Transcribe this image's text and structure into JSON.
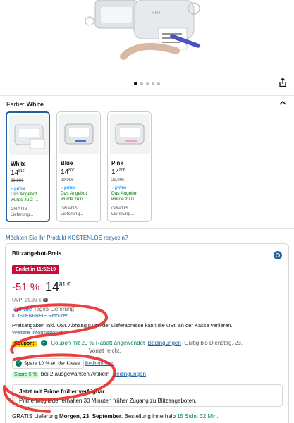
{
  "gallery": {
    "dots_count": 5,
    "active_dot": 0
  },
  "color_selector": {
    "label": "Farbe:",
    "selected": "White",
    "options": [
      {
        "name": "White",
        "price_whole": "14",
        "price_fraction": "81€",
        "old_price": "29,99€",
        "prime": "✓prime",
        "offer": "Das Angebot wurde zu 2 ...",
        "shipping": "GRATIS Lieferung...",
        "selected": true
      },
      {
        "name": "Blue",
        "price_whole": "14",
        "price_fraction": "80€",
        "old_price": "29,99€",
        "prime": "✓prime",
        "offer": "Das Angebot wurde zu 0 ...",
        "shipping": "GRATIS Lieferung...",
        "selected": false
      },
      {
        "name": "Pink",
        "price_whole": "14",
        "price_fraction": "80€",
        "old_price": "29,99€",
        "prime": "✓prime",
        "offer": "Das Angebot wurde zu 0 ...",
        "shipping": "GRATIS Lieferung...",
        "selected": false
      }
    ]
  },
  "recycle_link": "Möchten Sie Ihr Produkt KOSTENLOS recyceln?",
  "offer_card": {
    "title": "Blitzangebot-Preis",
    "deal_badge": "Endet in 11:52:19",
    "discount": "-51 %",
    "price_whole": "14",
    "price_fraction": "81 €",
    "uvp_label": "UVP:",
    "uvp_value": "29,99 €",
    "uvp_info": "i",
    "prime_label": "✓prime",
    "prime_text": "Tages-Lieferung",
    "returns": "KOSTENFREIE Retouren",
    "vat_text": "Preisangaben inkl. USt. Abhängig von der Lieferadresse kann die USt. an der Kasse variieren.",
    "vat_link": "Weitere Informationen.",
    "coupon_tag": "Coupon:",
    "coupon_text": "Coupon mit 20 % Rabatt angewendet",
    "coupon_terms": "Bedingungen",
    "coupon_valid": "Gültig bis Dienstag, 23.",
    "stock_text": "Vorrat reicht.",
    "save1_text": "Spare 10 % an der Kasse",
    "save1_link": "Bedingungen",
    "save2_chip": "Spare 5 %",
    "save2_text": "bei 2 ausgewählten Artikeln",
    "save2_link": "Bedingungen",
    "prime_box_title": "Jetzt mit Prime früher verfügbar",
    "prime_box_text": "Prime-Mitglieder erhalten 30 Minuten früher Zugang zu Blitzangeboten.",
    "delivery_prefix": "GRATIS Lieferung",
    "delivery_date": "Morgen, 23. September",
    "delivery_mid": ". Bestellung innerhalb",
    "delivery_countdown": "15 Stdn. 32 Min."
  },
  "colors": {
    "accent_blue": "#2162a1",
    "deal_red": "#cc0c39",
    "success_green": "#067d62",
    "prime_blue": "#1a98ff",
    "coupon_yellow": "#f7ca00",
    "annotation_red": "#e8211c"
  }
}
